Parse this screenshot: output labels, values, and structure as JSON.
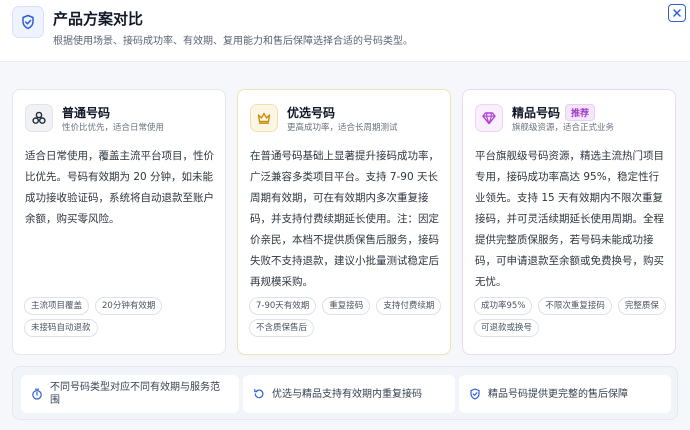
{
  "header": {
    "title": "产品方案对比",
    "subtitle": "根据使用场景、接码成功率、有效期、复用能力和售后保障选择合适的号码类型。",
    "icon": "shield-check-icon",
    "close_icon": "close-icon"
  },
  "cards": [
    {
      "title": "普通号码",
      "subtitle": "性价比优先，适合日常使用",
      "icon": "cluster-icon",
      "description": "适合日常使用，覆盖主流平台项目，性价比优先。号码有效期为 20 分钟，如未能成功接收验证码，系统将自动退款至账户余额，购买零风险。",
      "tags": [
        "主流项目覆盖",
        "20分钟有效期",
        "未接码自动退款"
      ]
    },
    {
      "title": "优选号码",
      "subtitle": "更高成功率，适合长周期测试",
      "icon": "crown-icon",
      "description": "在普通号码基础上显著提升接码成功率，广泛兼容多类项目平台。支持 7-90 天长周期有效期，可在有效期内多次重复接码，并支持付费续期延长使用。注：因定价亲民，本档不提供质保售后服务，接码失败不支持退款，建议小批量测试稳定后再规模采购。",
      "tags": [
        "7-90天有效期",
        "重复接码",
        "支持付费续期",
        "不含质保售后"
      ]
    },
    {
      "title": "精品号码",
      "badge": "推荐",
      "subtitle": "旗舰级资源，适合正式业务",
      "icon": "diamond-icon",
      "description": "平台旗舰级号码资源，精选主流热门项目专用，接码成功率高达 95%，稳定性行业领先。支持 15 天有效期内不限次重复接码，并可灵活续期延长使用周期。全程提供完整质保服务，若号码未能成功接码，可申请退款至余额或免费换号，购买无忧。",
      "tags": [
        "成功率95%",
        "不限次重复接码",
        "完整质保",
        "可退款或换号"
      ]
    }
  ],
  "footer": [
    {
      "text": "不同号码类型对应不同有效期与服务范围",
      "icon": "timer-icon"
    },
    {
      "text": "优选与精品支持有效期内重复接码",
      "icon": "refresh-icon"
    },
    {
      "text": "精品号码提供更完整的售后保障",
      "icon": "shield-check-icon"
    }
  ],
  "colors": {
    "accent": "#2f5fd8",
    "gold": "#c9900f",
    "purple": "#b03fd6"
  }
}
